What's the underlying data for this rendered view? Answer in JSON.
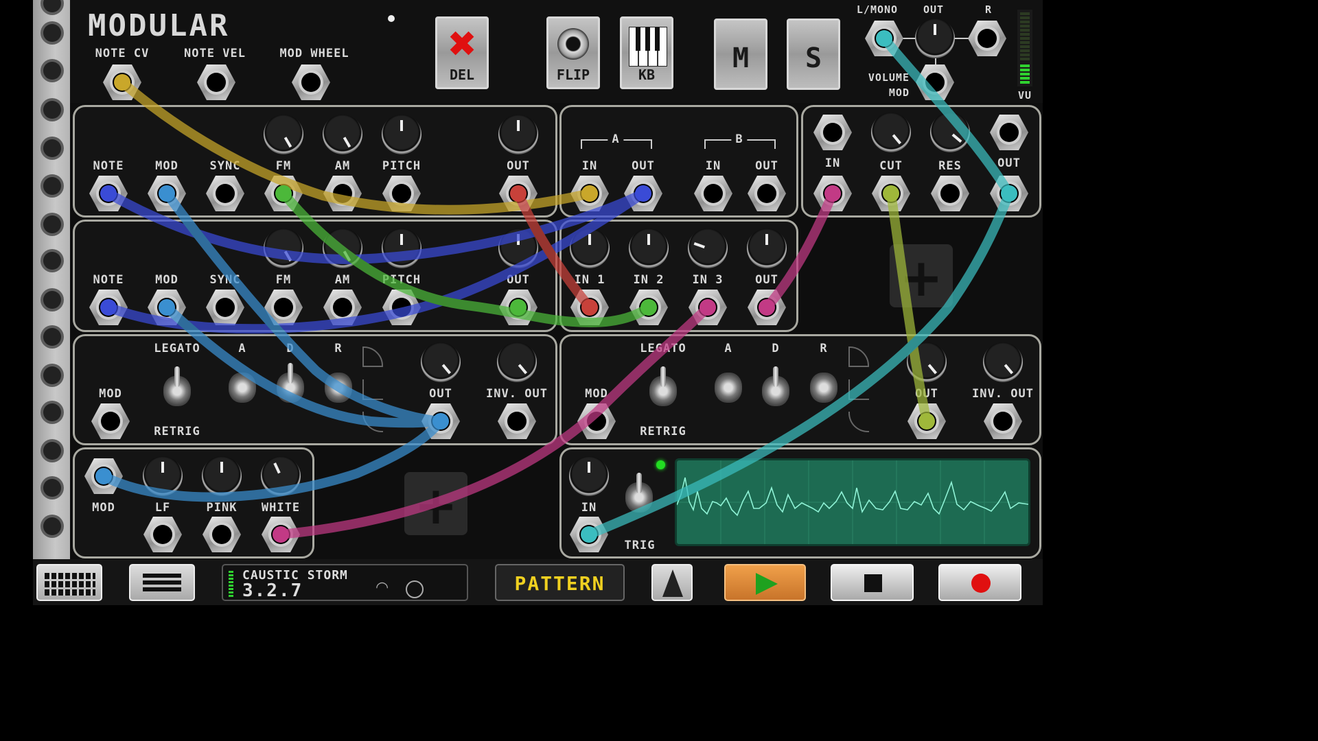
{
  "app": {
    "title": "MODULAR",
    "colors": {
      "accent_play": "#e38a2c",
      "pattern_text": "#f0d020",
      "record": "#e01010",
      "led_on": "#22dd22"
    }
  },
  "header": {
    "inputs": [
      {
        "label": "NOTE CV",
        "cable": "yellow"
      },
      {
        "label": "NOTE VEL",
        "cable": null
      },
      {
        "label": "MOD WHEEL",
        "cable": null
      }
    ],
    "buttons": {
      "del": {
        "label": "DEL",
        "icon": "x-icon"
      },
      "flip": {
        "label": "FLIP",
        "icon": "jack-icon"
      },
      "kb": {
        "label": "KB",
        "icon": "piano-keys-icon"
      },
      "mute": {
        "label": "M"
      },
      "solo": {
        "label": "S"
      }
    },
    "output": {
      "labels": {
        "left": "L/MONO",
        "out": "OUT",
        "right": "R",
        "volume_mod": "VOLUME MOD",
        "vu": "VU"
      }
    }
  },
  "modules": {
    "osc1": {
      "knob_labels": [
        "FM",
        "AM",
        "PITCH",
        "OUT"
      ],
      "jack_labels": [
        "NOTE",
        "MOD",
        "SYNC",
        "FM",
        "AM",
        "PITCH",
        "OUT"
      ]
    },
    "osc2": {
      "jack_labels": [
        "NOTE",
        "MOD",
        "SYNC",
        "FM",
        "AM",
        "PITCH",
        "OUT"
      ]
    },
    "vca": {
      "group_a": "A",
      "group_b": "B",
      "jack_labels": [
        "IN",
        "OUT",
        "IN",
        "OUT"
      ]
    },
    "filter": {
      "jack_labels": [
        "IN",
        "CUT",
        "RES",
        "OUT"
      ]
    },
    "mixer": {
      "jack_labels": [
        "IN 1",
        "IN 2",
        "IN 3",
        "OUT"
      ]
    },
    "env1": {
      "labels": {
        "legato": "LEGATO",
        "retrig": "RETRIG",
        "a": "A",
        "d": "D",
        "r": "R",
        "mod": "MOD",
        "out": "OUT",
        "inv_out": "INV. OUT"
      }
    },
    "env2": {
      "labels": {
        "legato": "LEGATO",
        "retrig": "RETRIG",
        "a": "A",
        "d": "D",
        "r": "R",
        "mod": "MOD",
        "out": "OUT",
        "inv_out": "INV. OUT"
      }
    },
    "noise": {
      "labels": {
        "mod": "MOD",
        "lf": "LF",
        "pink": "PINK",
        "white": "WHITE"
      }
    },
    "scope": {
      "labels": {
        "in": "IN",
        "trig": "TRIG"
      }
    },
    "add_slot_label": "+"
  },
  "bottom_bar": {
    "song_name": "CAUSTIC STORM",
    "version": "3.2.7",
    "pattern_label": "PATTERN",
    "icons": [
      "grid-icon",
      "menu-icon",
      "wifi-icon",
      "midi-icon",
      "metronome-icon",
      "play-icon",
      "stop-icon",
      "record-icon"
    ]
  }
}
